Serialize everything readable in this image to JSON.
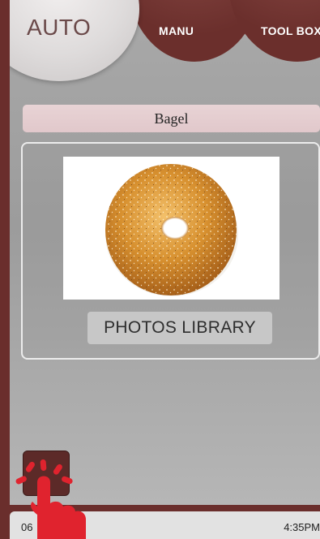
{
  "tabs": {
    "auto": "AUTO",
    "manu": "MANU",
    "toolbox": "TOOL BOX"
  },
  "program": {
    "name": "Bagel",
    "image_icon": "bagel-photo",
    "photos_button": "PHOTOS LIBRARY"
  },
  "status": {
    "left": "06",
    "time": "4:35PM"
  },
  "colors": {
    "accent": "#6b2f2c",
    "tap_hint": "#e0232e"
  }
}
